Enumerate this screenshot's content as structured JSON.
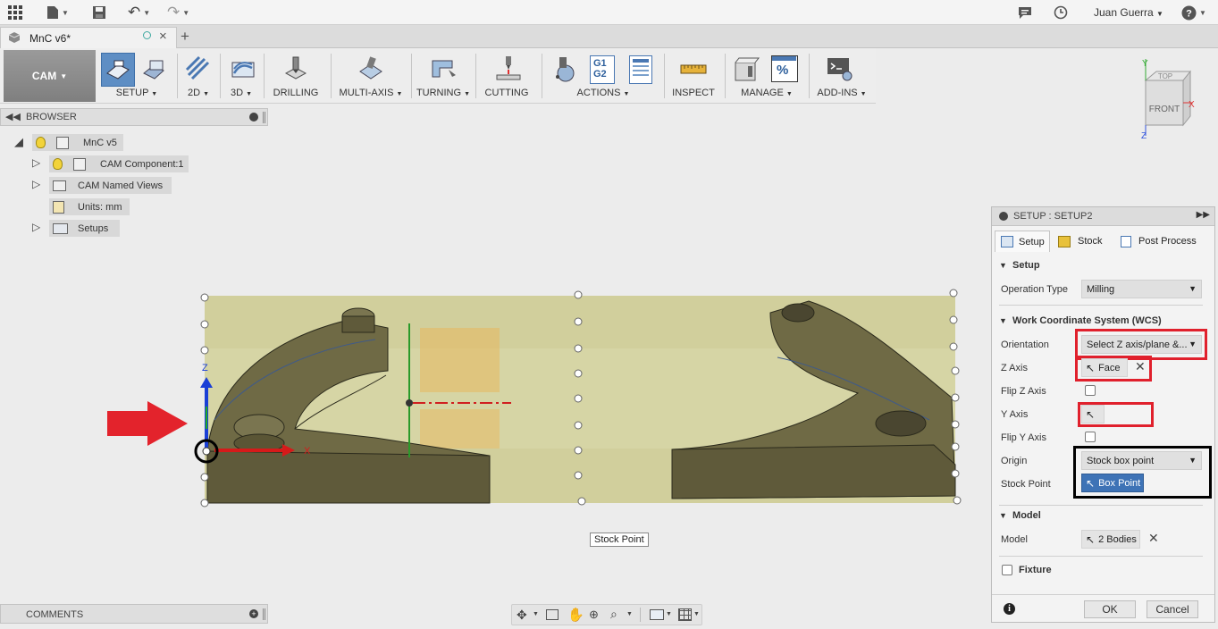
{
  "topbar": {
    "user_name": "Juan Guerra",
    "icons": [
      "apps-grid-icon",
      "file-icon",
      "save-icon",
      "undo-icon",
      "redo-icon",
      "chat-icon",
      "history-icon",
      "help-icon"
    ]
  },
  "tab": {
    "label": "MnC v6*"
  },
  "ribbon": {
    "workspace": "CAM",
    "groups": {
      "setup": "SETUP",
      "d2": "2D",
      "d3": "3D",
      "drilling": "DRILLING",
      "multiaxis": "MULTI-AXIS",
      "turning": "TURNING",
      "cutting": "CUTTING",
      "actions": "ACTIONS",
      "inspect": "INSPECT",
      "manage": "MANAGE",
      "addins": "ADD-INS"
    },
    "g1g2": [
      "G1",
      "G2"
    ]
  },
  "browser": {
    "title": "BROWSER",
    "items": [
      {
        "label": "MnC v5"
      },
      {
        "label": "CAM Component:1"
      },
      {
        "label": "CAM Named Views"
      },
      {
        "label": "Units: mm"
      },
      {
        "label": "Setups"
      }
    ]
  },
  "viewport": {
    "tooltip": "Stock Point",
    "axis_labels": {
      "z": "Z",
      "x": "X"
    }
  },
  "viewcube": {
    "top": "TOP",
    "front": "FRONT",
    "x": "X",
    "y": "Y",
    "z": "Z"
  },
  "comments": {
    "label": "COMMENTS"
  },
  "panel": {
    "title": "SETUP : SETUP2",
    "tabs": {
      "setup": "Setup",
      "stock": "Stock",
      "post": "Post Process"
    },
    "sections": {
      "setup": "Setup",
      "wcs": "Work Coordinate System (WCS)",
      "model": "Model",
      "fixture": "Fixture"
    },
    "fields": {
      "operation_type_label": "Operation Type",
      "operation_type_value": "Milling",
      "orientation_label": "Orientation",
      "orientation_value": "Select Z axis/plane &...",
      "z_axis_label": "Z Axis",
      "z_axis_value": "Face",
      "flip_z_label": "Flip Z Axis",
      "y_axis_label": "Y Axis",
      "flip_y_label": "Flip Y Axis",
      "origin_label": "Origin",
      "origin_value": "Stock box point",
      "stock_point_label": "Stock Point",
      "stock_point_value": "Box Point",
      "model_label": "Model",
      "model_value": "2 Bodies"
    },
    "buttons": {
      "ok": "OK",
      "cancel": "Cancel"
    }
  }
}
